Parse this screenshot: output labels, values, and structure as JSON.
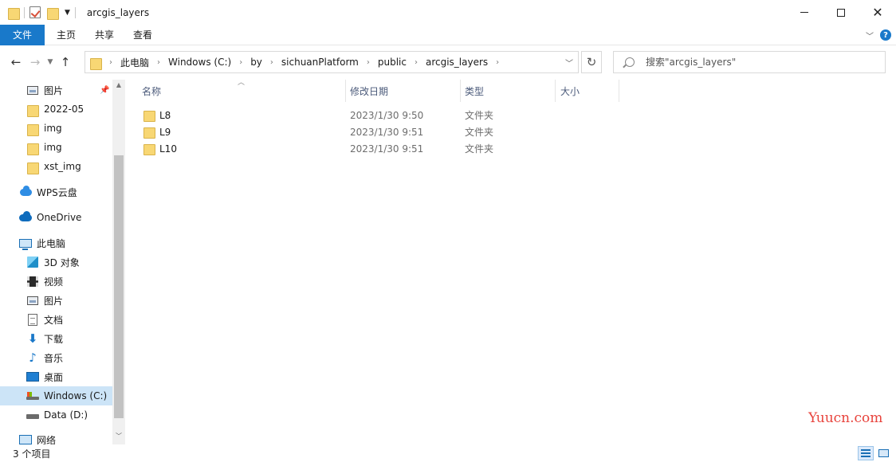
{
  "window": {
    "title": "arcgis_layers"
  },
  "ribbon": {
    "tabs": [
      {
        "label": "文件"
      },
      {
        "label": "主页"
      },
      {
        "label": "共享"
      },
      {
        "label": "查看"
      }
    ]
  },
  "address": {
    "segments": [
      "此电脑",
      "Windows (C:)",
      "by",
      "sichuanPlatform",
      "public",
      "arcgis_layers"
    ]
  },
  "search": {
    "placeholder": "搜索\"arcgis_layers\""
  },
  "sidebar": {
    "items": [
      {
        "label": "图片",
        "icon": "pictures-icon"
      },
      {
        "label": "2022-05",
        "icon": "folder-icon"
      },
      {
        "label": "img",
        "icon": "folder-icon"
      },
      {
        "label": "img",
        "icon": "folder-icon"
      },
      {
        "label": "xst_img",
        "icon": "folder-icon"
      },
      {
        "label": "WPS云盘",
        "icon": "wps-cloud-icon"
      },
      {
        "label": "OneDrive",
        "icon": "onedrive-icon"
      },
      {
        "label": "此电脑",
        "icon": "this-pc-icon"
      },
      {
        "label": "3D 对象",
        "icon": "3d-objects-icon"
      },
      {
        "label": "视频",
        "icon": "videos-icon"
      },
      {
        "label": "图片",
        "icon": "pictures-icon"
      },
      {
        "label": "文档",
        "icon": "documents-icon"
      },
      {
        "label": "下载",
        "icon": "downloads-icon"
      },
      {
        "label": "音乐",
        "icon": "music-icon"
      },
      {
        "label": "桌面",
        "icon": "desktop-icon"
      },
      {
        "label": "Windows (C:)",
        "icon": "drive-c-icon"
      },
      {
        "label": "Data (D:)",
        "icon": "drive-d-icon"
      },
      {
        "label": "网络",
        "icon": "network-icon"
      }
    ]
  },
  "columns": {
    "name": "名称",
    "modified": "修改日期",
    "type": "类型",
    "size": "大小"
  },
  "files": [
    {
      "name": "L8",
      "modified": "2023/1/30 9:50",
      "type": "文件夹"
    },
    {
      "name": "L9",
      "modified": "2023/1/30 9:51",
      "type": "文件夹"
    },
    {
      "name": "L10",
      "modified": "2023/1/30 9:51",
      "type": "文件夹"
    }
  ],
  "status": {
    "count": "3 个项目"
  },
  "watermark": "Yuucn.com"
}
